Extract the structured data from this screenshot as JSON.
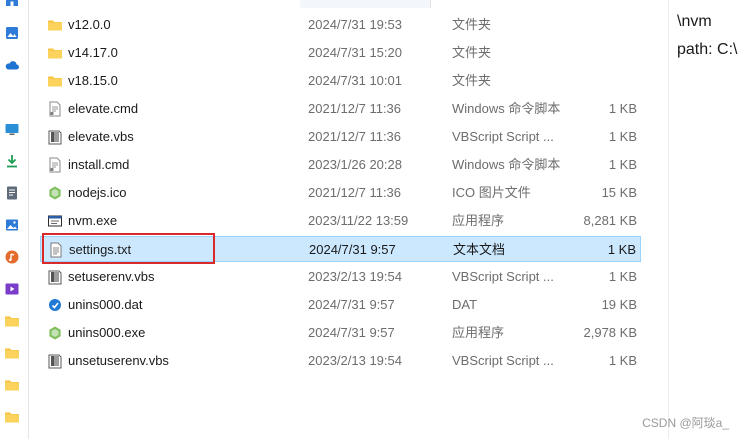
{
  "colors": {
    "accent": "#0067c0",
    "selection": "#cce8ff",
    "highlight_box": "#d9292b",
    "folder": "#f7c340"
  },
  "nav": [
    {
      "icon": "home-icon",
      "color": "#2f7bd8"
    },
    {
      "icon": "gallery-icon",
      "color": "#2f7bd8"
    },
    {
      "icon": "onedrive-icon",
      "color": "#1e73d2"
    },
    {
      "icon": "desktop-icon",
      "color": "#2a8fd6"
    },
    {
      "icon": "downloads-icon",
      "color": "#1f9c54"
    },
    {
      "icon": "documents-icon",
      "color": "#5f6b7a"
    },
    {
      "icon": "pictures-icon",
      "color": "#2f7bd8"
    },
    {
      "icon": "music-icon",
      "color": "#e46b2b"
    },
    {
      "icon": "videos-icon",
      "color": "#7a3cc9"
    },
    {
      "icon": "folder-icon",
      "color": "#f7c340"
    },
    {
      "icon": "folder-icon",
      "color": "#f7c340"
    },
    {
      "icon": "folder-icon",
      "color": "#f7c340"
    },
    {
      "icon": "folder-icon",
      "color": "#f7c340"
    }
  ],
  "files": [
    {
      "name": "v12.0.0",
      "date": "2024/7/31 19:53",
      "type": "文件夹",
      "size": "",
      "icon": "folder-icon"
    },
    {
      "name": "v14.17.0",
      "date": "2024/7/31 15:20",
      "type": "文件夹",
      "size": "",
      "icon": "folder-icon"
    },
    {
      "name": "v18.15.0",
      "date": "2024/7/31 10:01",
      "type": "文件夹",
      "size": "",
      "icon": "folder-icon"
    },
    {
      "name": "elevate.cmd",
      "date": "2021/12/7 11:36",
      "type": "Windows 命令脚本",
      "size": "1 KB",
      "icon": "cmd-file-icon"
    },
    {
      "name": "elevate.vbs",
      "date": "2021/12/7 11:36",
      "type": "VBScript Script ...",
      "size": "1 KB",
      "icon": "vbs-file-icon"
    },
    {
      "name": "install.cmd",
      "date": "2023/1/26 20:28",
      "type": "Windows 命令脚本",
      "size": "1 KB",
      "icon": "cmd-file-icon"
    },
    {
      "name": "nodejs.ico",
      "date": "2021/12/7 11:36",
      "type": "ICO 图片文件",
      "size": "15 KB",
      "icon": "nodejs-icon"
    },
    {
      "name": "nvm.exe",
      "date": "2023/11/22 13:59",
      "type": "应用程序",
      "size": "8,281 KB",
      "icon": "exe-file-icon"
    },
    {
      "name": "settings.txt",
      "date": "2024/7/31 9:57",
      "type": "文本文档",
      "size": "1 KB",
      "icon": "text-file-icon",
      "selected": true
    },
    {
      "name": "setuserenv.vbs",
      "date": "2023/2/13 19:54",
      "type": "VBScript Script ...",
      "size": "1 KB",
      "icon": "vbs-file-icon"
    },
    {
      "name": "unins000.dat",
      "date": "2024/7/31 9:57",
      "type": "DAT",
      "size": "19 KB",
      "icon": "dat-file-icon"
    },
    {
      "name": "unins000.exe",
      "date": "2024/7/31 9:57",
      "type": "应用程序",
      "size": "2,978 KB",
      "icon": "nodejs-icon"
    },
    {
      "name": "unsetuserenv.vbs",
      "date": "2023/2/13 19:54",
      "type": "VBScript Script ...",
      "size": "1 KB",
      "icon": "vbs-file-icon"
    }
  ],
  "preview": {
    "line1": "\\nvm",
    "line2": "path: C:\\"
  },
  "watermark": "CSDN @阿琰a_"
}
